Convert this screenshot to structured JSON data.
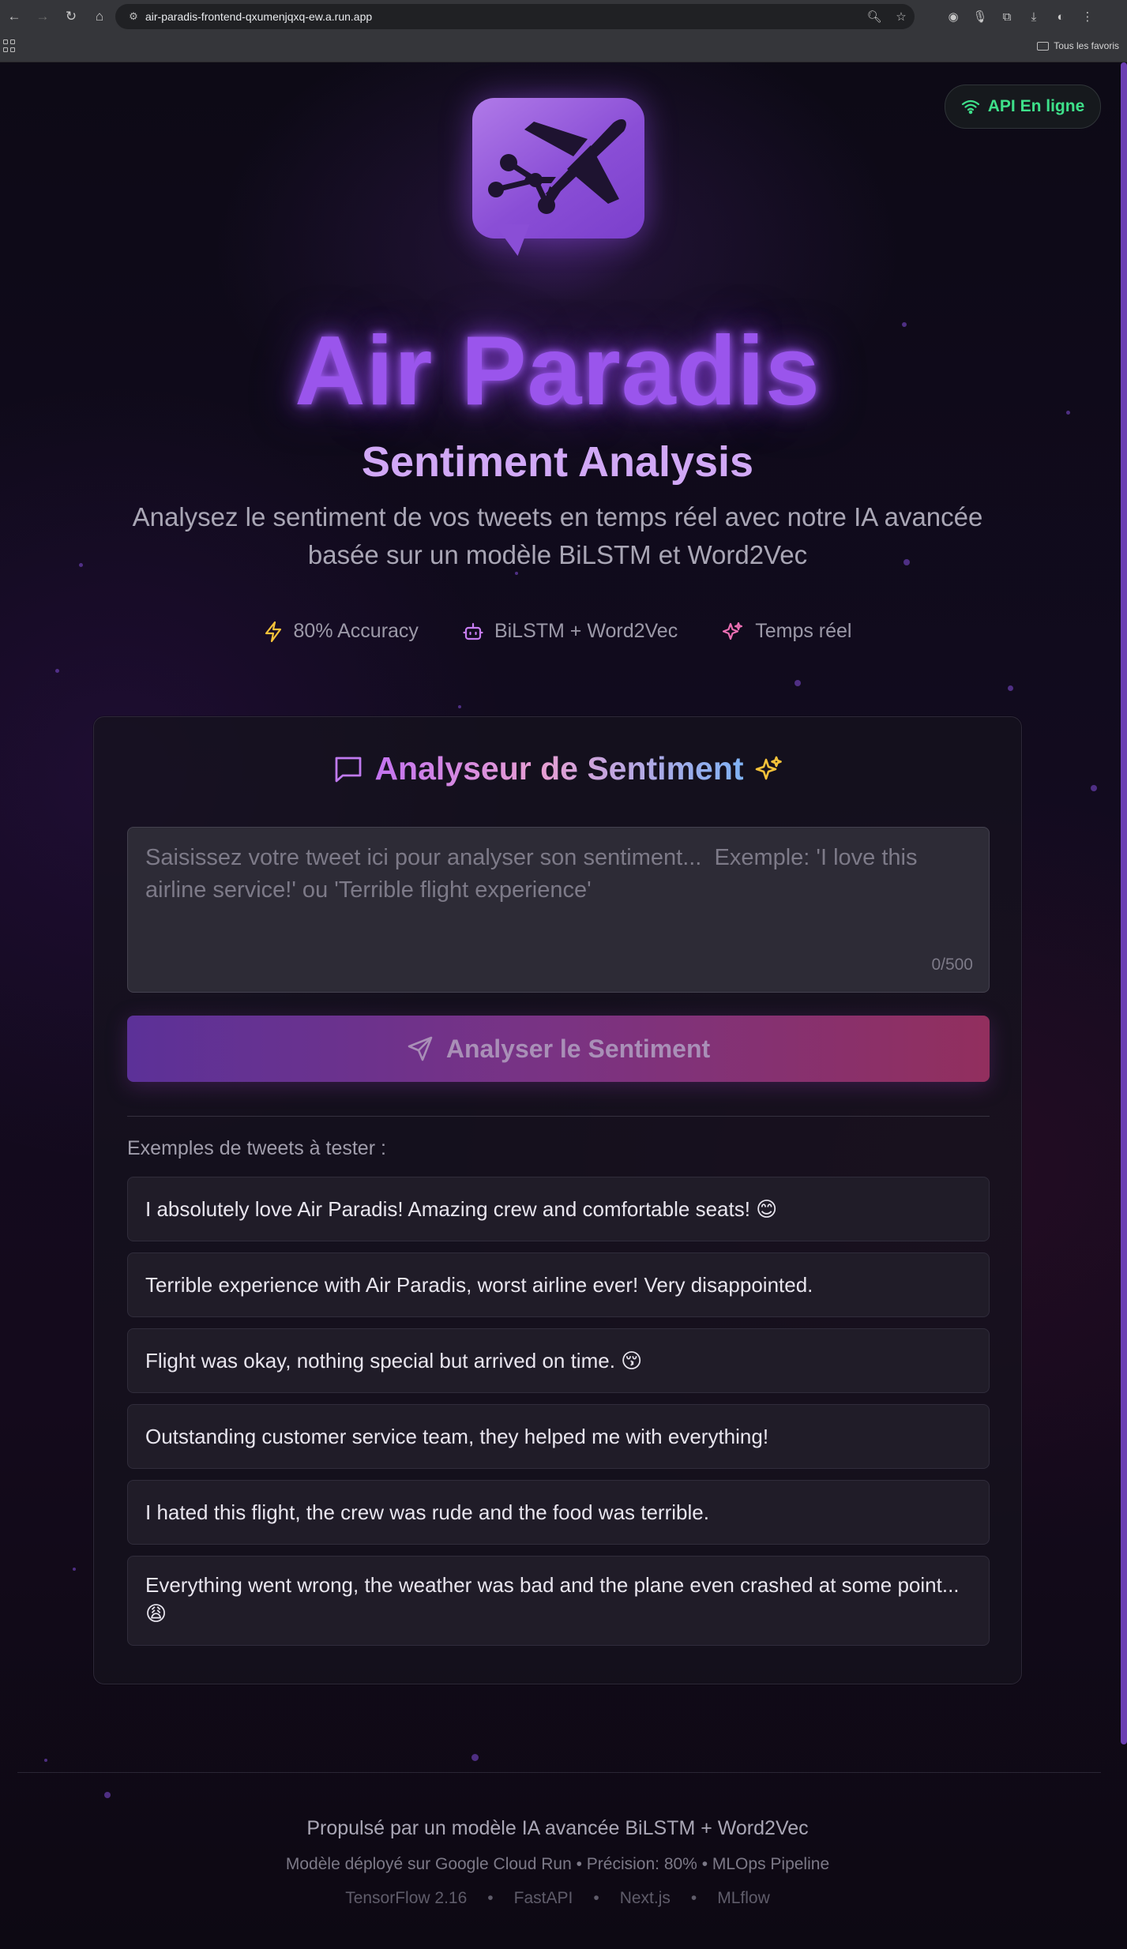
{
  "browser": {
    "url": "air-paradis-frontend-qxumenjqxq-ew.a.run.app",
    "bookmark_folder": "Tous les favoris"
  },
  "status": {
    "label": "API En ligne",
    "color": "#3ee08a"
  },
  "hero": {
    "title": "Air Paradis",
    "subtitle": "Sentiment Analysis",
    "description": "Analysez le sentiment de vos tweets en temps réel avec notre IA avancée basée sur un modèle BiLSTM et Word2Vec",
    "features": [
      {
        "icon": "lightning-icon",
        "label": "80% Accuracy",
        "color": "#f5c23a"
      },
      {
        "icon": "robot-icon",
        "label": "BiLSTM + Word2Vec",
        "color": "#c77df2"
      },
      {
        "icon": "sparkles-icon",
        "label": "Temps réel",
        "color": "#ec6fb3"
      }
    ]
  },
  "analyzer": {
    "title": "Analyseur de Sentiment",
    "placeholder": "Saisissez votre tweet ici pour analyser son sentiment...  Exemple: 'I love this airline service!' ou 'Terrible flight experience'",
    "value": "",
    "counter": "0/500",
    "button_label": "Analyser le Sentiment",
    "examples_label": "Exemples de tweets à tester :",
    "examples": [
      "I absolutely love Air Paradis! Amazing crew and comfortable seats! 😊",
      "Terrible experience with Air Paradis, worst airline ever! Very disappointed.",
      "Flight was okay, nothing special but arrived on time. 😚",
      "Outstanding customer service team, they helped me with everything!",
      "I hated this flight, the crew was rude and the food was terrible.",
      "Everything went wrong, the weather was bad and the plane even crashed at some point... 😩"
    ]
  },
  "footer": {
    "powered_by": "Propulsé par un modèle IA avancée BiLSTM + Word2Vec",
    "deployment": "Modèle déployé sur Google Cloud Run • Précision: 80% • MLOps Pipeline",
    "tech": [
      "TensorFlow 2.16",
      "FastAPI",
      "Next.js",
      "MLflow"
    ],
    "separator": "•"
  }
}
